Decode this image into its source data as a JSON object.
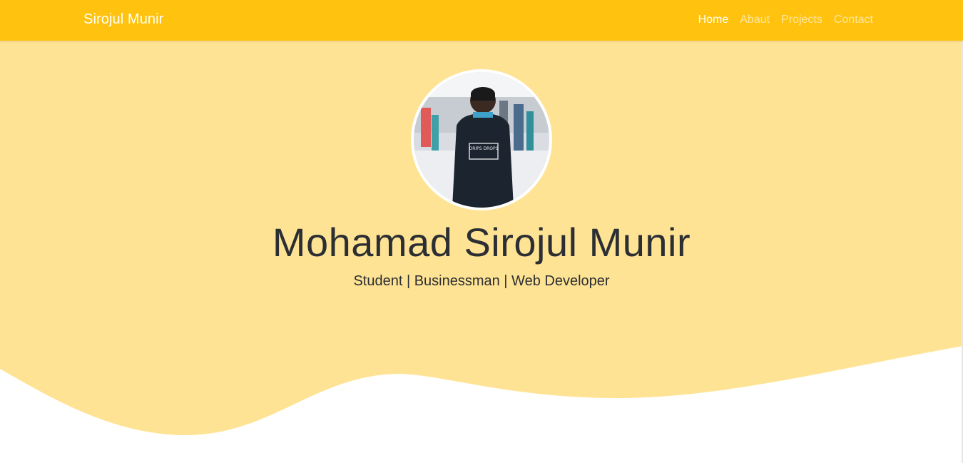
{
  "navbar": {
    "brand": "Sirojul Munir",
    "links": [
      {
        "label": "Home",
        "active": true
      },
      {
        "label": "Abaut",
        "active": false
      },
      {
        "label": "Projects",
        "active": false
      },
      {
        "label": "Contact",
        "active": false
      }
    ]
  },
  "hero": {
    "name": "Mohamad Sirojul Munir",
    "tagline": "Student | Businessman | Web Developer",
    "avatar_alt": "profile photo",
    "avatar_print": "DRIPS DROPS"
  },
  "colors": {
    "navbar": "#ffc20e",
    "hero": "#ffe394",
    "text": "#2b2f33"
  }
}
